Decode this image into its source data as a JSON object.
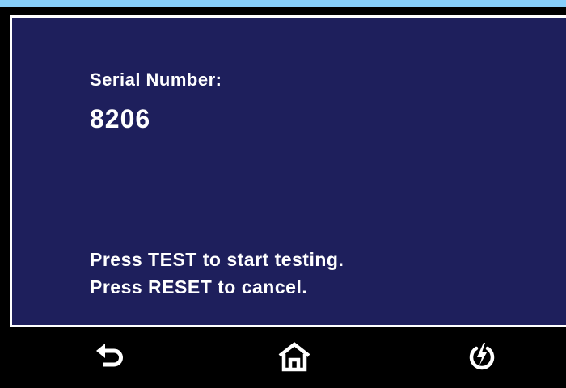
{
  "theme": {
    "panel_bg": "#1e1f5c",
    "frame_bg": "#000000",
    "top_strip": "#87cefa",
    "text": "#ffffff"
  },
  "main": {
    "serial_label": "Serial Number:",
    "serial_value": "8206",
    "instructions": [
      "Press TEST to start testing.",
      "Press RESET to cancel."
    ]
  },
  "nav": {
    "buttons": [
      {
        "name": "back",
        "icon": "back-arrow-icon"
      },
      {
        "name": "home",
        "icon": "home-icon"
      },
      {
        "name": "power",
        "icon": "power-icon"
      }
    ]
  }
}
